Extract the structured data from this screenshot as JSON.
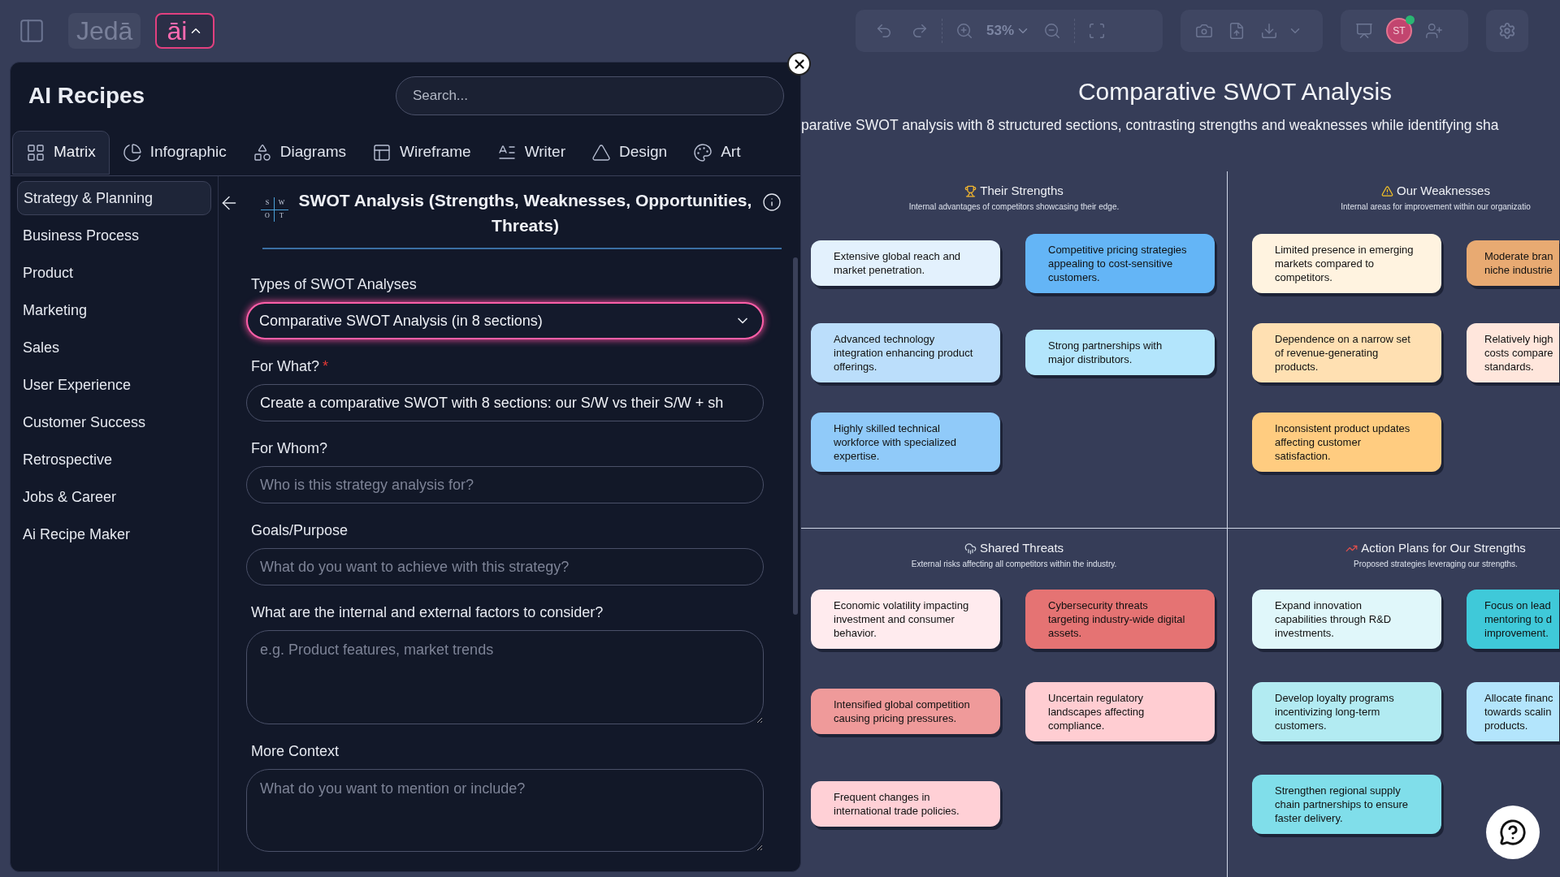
{
  "topbar": {
    "logo": "Jedā",
    "ai_button": "āi",
    "zoom": "53%",
    "avatar": "ST",
    "avatar_online": true
  },
  "panel": {
    "title": "AI Recipes",
    "search": {
      "placeholder": "Search..."
    },
    "tabs": [
      {
        "label": "Matrix",
        "selected": true
      },
      {
        "label": "Infographic",
        "selected": false
      },
      {
        "label": "Diagrams",
        "selected": false
      },
      {
        "label": "Wireframe",
        "selected": false
      },
      {
        "label": "Writer",
        "selected": false
      },
      {
        "label": "Design",
        "selected": false
      },
      {
        "label": "Art",
        "selected": false
      }
    ],
    "categories": [
      {
        "label": "Strategy & Planning",
        "selected": true
      },
      {
        "label": "Business Process",
        "selected": false
      },
      {
        "label": "Product",
        "selected": false
      },
      {
        "label": "Marketing",
        "selected": false
      },
      {
        "label": "Sales",
        "selected": false
      },
      {
        "label": "User Experience",
        "selected": false
      },
      {
        "label": "Customer Success",
        "selected": false
      },
      {
        "label": "Retrospective",
        "selected": false
      },
      {
        "label": "Jobs & Career",
        "selected": false
      },
      {
        "label": "Ai Recipe Maker",
        "selected": false
      }
    ],
    "recipe": {
      "icon_letters": [
        "S",
        "W",
        "O",
        "T"
      ],
      "title": "SWOT Analysis (Strengths, Weaknesses, Opportunities, Threats)",
      "fields": [
        {
          "kind": "select",
          "label": "Types of SWOT Analyses",
          "value": "Comparative SWOT Analysis (in 8 sections)",
          "focused": true
        },
        {
          "kind": "input",
          "label": "For What?",
          "required_mark": "*",
          "value": "Create a comparative SWOT with 8 sections: our S/W vs their S/W + sh"
        },
        {
          "kind": "input",
          "label": "For Whom?",
          "placeholder": "Who is this strategy analysis for?"
        },
        {
          "kind": "input",
          "label": "Goals/Purpose",
          "placeholder": "What do you want to achieve with this strategy?"
        },
        {
          "kind": "textarea",
          "label": "What are the internal and external factors to consider?",
          "placeholder": "e.g. Product features, market trends"
        },
        {
          "kind": "textarea",
          "label": "More Context",
          "placeholder": "What do you want to mention or include?"
        }
      ]
    }
  },
  "canvas": {
    "title": "Comparative SWOT Analysis",
    "subtitle": "parative SWOT analysis with 8 structured sections, contrasting strengths and weaknesses while identifying sha",
    "quadrants": [
      {
        "title": "Their Strengths",
        "subtitle": "Internal advantages of competitors showcasing their edge.",
        "rows": [
          [
            {
              "lines": [
                "Extensive global reach and",
                "market penetration."
              ],
              "color": "#e3f1fd"
            },
            {
              "lines": [
                "Competitive pricing strategies",
                "appealing to cost-sensitive",
                "customers."
              ],
              "color": "#64b5f6"
            }
          ],
          [
            {
              "lines": [
                "Advanced technology",
                "integration enhancing product",
                "offerings."
              ],
              "color": "#bbdefb"
            },
            {
              "lines": [
                "Strong partnerships with",
                "major distributors."
              ],
              "color": "#b3e5fc"
            }
          ],
          [
            {
              "lines": [
                "Highly skilled technical",
                "workforce with specialized",
                "expertise."
              ],
              "color": "#90caf9"
            }
          ]
        ]
      },
      {
        "title": "Our Weaknesses",
        "subtitle": "Internal areas for improvement within our organizatio",
        "rows": [
          [
            {
              "lines": [
                "Limited presence in emerging",
                "markets compared to",
                "competitors."
              ],
              "color": "#fff3e0"
            },
            {
              "lines": [
                "Moderate bran",
                "niche industrie"
              ],
              "color": "#e8aa72"
            }
          ],
          [
            {
              "lines": [
                "Dependence on a narrow set",
                "of revenue-generating",
                "products."
              ],
              "color": "#ffe0b2"
            },
            {
              "lines": [
                "Relatively high",
                "costs compare",
                "standards."
              ],
              "color": "#ffe6dc"
            }
          ],
          [
            {
              "lines": [
                "Inconsistent product updates",
                "affecting customer",
                "satisfaction."
              ],
              "color": "#ffcc80"
            }
          ]
        ]
      },
      {
        "title": "Shared Threats",
        "subtitle": "External risks affecting all competitors within the industry.",
        "rows": [
          [
            {
              "lines": [
                "Economic volatility impacting",
                "investment and consumer",
                "behavior."
              ],
              "color": "#ffebee"
            },
            {
              "lines": [
                "Cybersecurity threats",
                "targeting industry-wide digital",
                "assets."
              ],
              "color": "#e57373"
            }
          ],
          [
            {
              "lines": [
                "Intensified global competition",
                "causing pricing pressures."
              ],
              "color": "#ef9a9a"
            },
            {
              "lines": [
                "Uncertain regulatory",
                "landscapes affecting",
                "compliance."
              ],
              "color": "#ffcdd2"
            }
          ],
          [
            {
              "lines": [
                "Frequent changes in",
                "international trade policies."
              ],
              "color": "#ffd0d6"
            }
          ]
        ]
      },
      {
        "title": "Action Plans for Our Strengths",
        "subtitle": "Proposed strategies leveraging our strengths.",
        "rows": [
          [
            {
              "lines": [
                "Expand innovation",
                "capabilities through R&D",
                "investments."
              ],
              "color": "#e0f7fa"
            },
            {
              "lines": [
                "Focus on lead",
                "mentoring to d",
                "improvement."
              ],
              "color": "#3fc9d9"
            }
          ],
          [
            {
              "lines": [
                "Develop loyalty programs",
                "incentivizing long-term",
                "customers."
              ],
              "color": "#b2ebf2"
            },
            {
              "lines": [
                "Allocate financ",
                "towards scalin",
                "products."
              ],
              "color": "#b3e5fc"
            }
          ],
          [
            {
              "lines": [
                "Strengthen regional supply",
                "chain partnerships to ensure",
                "faster delivery."
              ],
              "color": "#80deea"
            }
          ]
        ]
      }
    ]
  }
}
